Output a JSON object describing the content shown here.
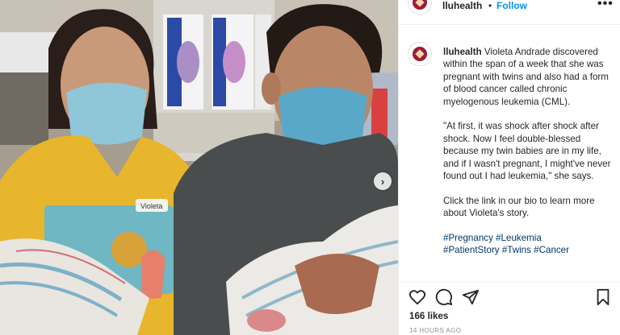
{
  "photo": {
    "icons": {
      "next": "chevron-right-icon"
    },
    "badge_text": "Violeta"
  },
  "header": {
    "username": "lluhealth",
    "separator": "•",
    "follow_label": "Follow",
    "more_label": "•••"
  },
  "caption": {
    "username": "lluhealth",
    "paragraphs": [
      "Violeta Andrade discovered within the span of a week that she was pregnant with twins and also had a form of blood cancer called chronic myelogenous leukemia (CML).",
      "\"At first, it was shock after shock after shock. Now I feel double-blessed because my twin babies are in my life, and if I wasn't pregnant, I might've never found out I had leukemia,\" she says.",
      "Click the link in our bio to learn more about Violeta's story."
    ],
    "hashtags": [
      "#Pregnancy",
      "#Leukemia",
      "#PatientStory",
      "#Twins",
      "#Cancer"
    ]
  },
  "actions": {
    "icons": [
      "heart-icon",
      "comment-icon",
      "share-icon",
      "bookmark-icon"
    ]
  },
  "likes_label": "166 likes",
  "timestamp": "14 HOURS AGO",
  "colors": {
    "link": "#0095f6",
    "hashtag": "#00376b",
    "brand": "#9b1c3a"
  }
}
